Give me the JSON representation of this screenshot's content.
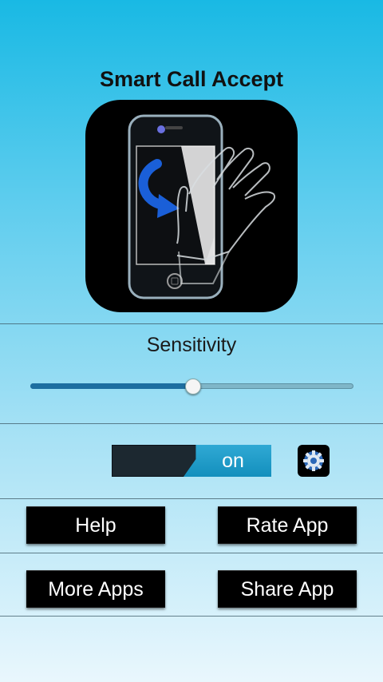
{
  "header": {
    "title": "Smart Call Accept"
  },
  "sensitivity": {
    "label": "Sensitivity",
    "value": 0.5
  },
  "toggle": {
    "state_label": "on"
  },
  "settings": {
    "icon": "gear-icon"
  },
  "buttons": {
    "help": "Help",
    "rate": "Rate App",
    "more": "More Apps",
    "share": "Share App"
  },
  "colors": {
    "accent": "#1d6ea0",
    "toggle_on": "#1f9cc9",
    "bg_top": "#19b9e4",
    "bg_bottom": "#e9f7fd"
  }
}
